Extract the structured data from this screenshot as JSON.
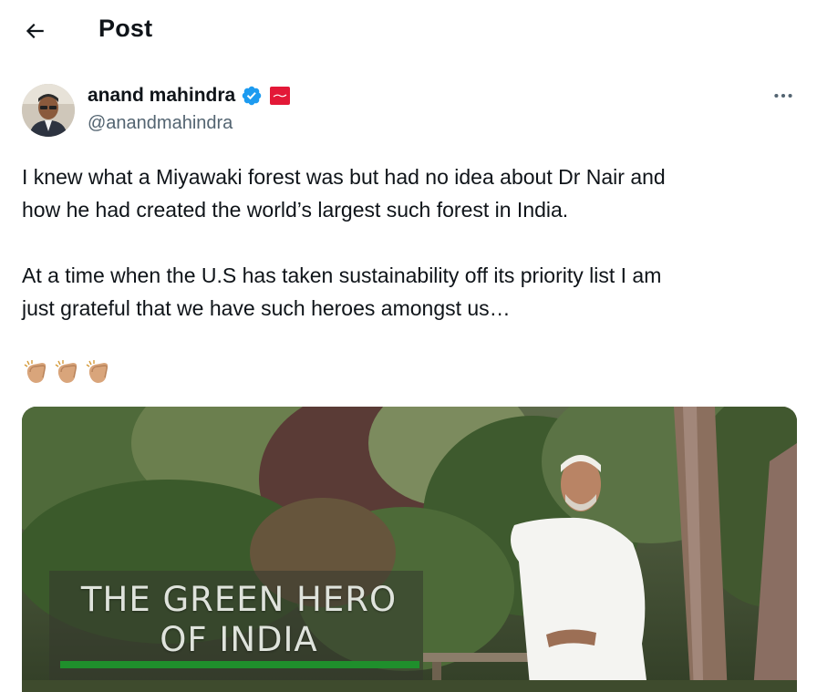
{
  "header": {
    "title": "Post",
    "back_icon": "arrow-left-icon"
  },
  "author": {
    "name": "anand mahindra",
    "handle": "@anandmahindra",
    "verified_icon": "verified-badge-icon",
    "verified_color": "#1d9bf0",
    "affiliation_icon": "mahindra-logo-icon",
    "affiliation_color": "#e31837"
  },
  "more_icon": "more-horizontal-icon",
  "tweet": {
    "paragraph1_line1": "I knew what a Miyawaki forest was but had no idea about Dr Nair and",
    "paragraph1_line2": "how he had created the world’s largest such forest  in India.",
    "paragraph2_line1": "At a time when the U.S has taken sustainability off its priority list I am",
    "paragraph2_line2": "just grateful that we have such heroes amongst us…",
    "emojis": [
      "👏🏼",
      "👏🏼",
      "👏🏼"
    ]
  },
  "media": {
    "overlay_line1": "THE GREEN HERO",
    "overlay_line2": "OF INDIA",
    "accent_color": "#1f8f2c"
  }
}
